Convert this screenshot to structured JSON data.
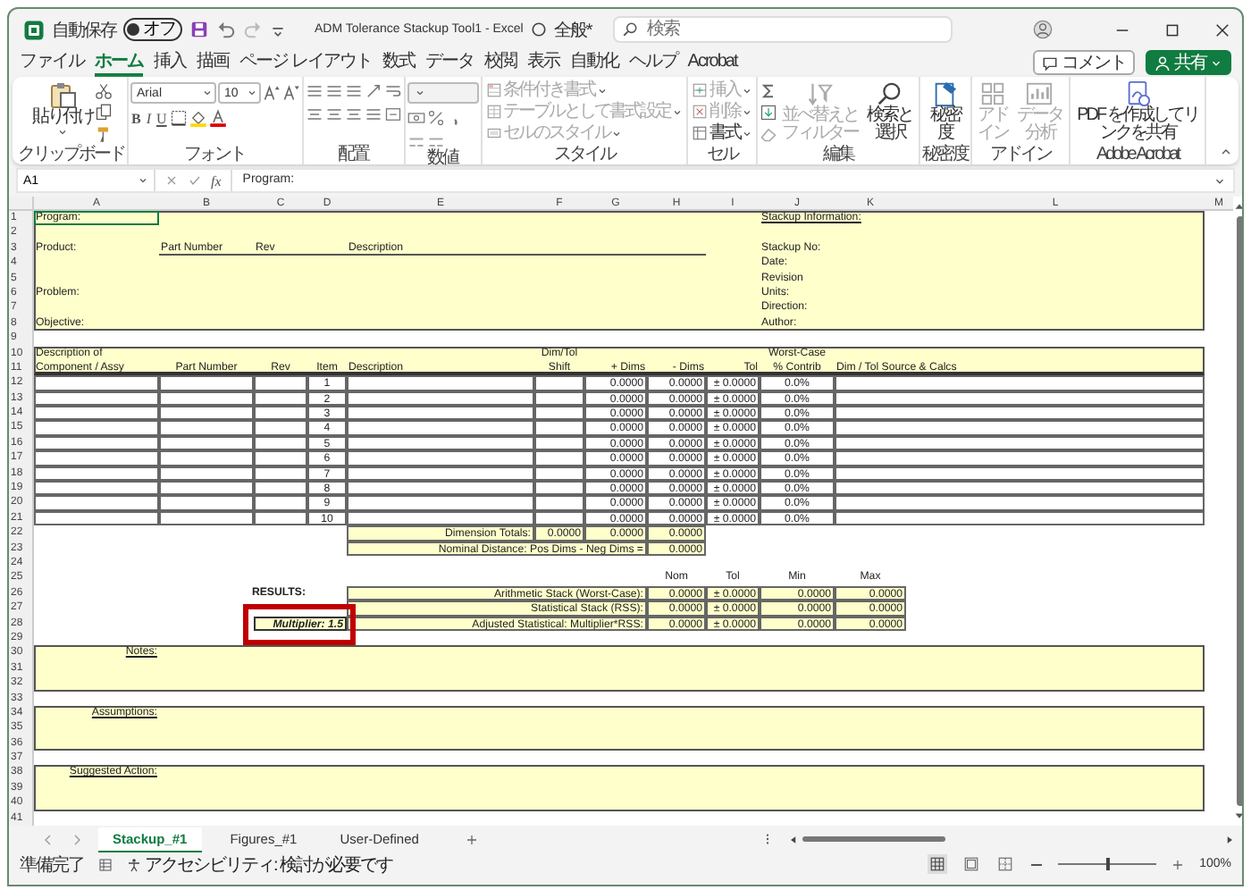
{
  "window": {
    "autosave": "自動保存",
    "autosave_state": "オフ",
    "autosave_on": false,
    "title": "ADM Tolerance Stackup Tool1 - Excel",
    "sensitivity": "全般*",
    "search_placeholder": "検索"
  },
  "menu_tabs": [
    {
      "label": "ファイル",
      "selected": false
    },
    {
      "label": "ホーム",
      "selected": true
    },
    {
      "label": "挿入",
      "selected": false
    },
    {
      "label": "描画",
      "selected": false
    },
    {
      "label": "ページ レイアウト",
      "selected": false
    },
    {
      "label": "数式",
      "selected": false
    },
    {
      "label": "データ",
      "selected": false
    },
    {
      "label": "校閲",
      "selected": false
    },
    {
      "label": "表示",
      "selected": false
    },
    {
      "label": "自動化",
      "selected": false
    },
    {
      "label": "ヘルプ",
      "selected": false
    },
    {
      "label": "Acrobat",
      "selected": false
    }
  ],
  "actions": {
    "comment": "コメント",
    "share": "共有"
  },
  "ribbon": [
    {
      "kind": "clipboard",
      "label": "クリップボード",
      "paste": "貼り付け"
    },
    {
      "kind": "font",
      "label": "フォント",
      "font": "Arial",
      "size": "10",
      "styles": [
        "B",
        "I",
        "U"
      ]
    },
    {
      "kind": "alignment",
      "label": "配置"
    },
    {
      "kind": "number",
      "label": "数値"
    },
    {
      "kind": "list",
      "label": "スタイル",
      "items": [
        {
          "label": "条件付き書式",
          "disabled": true
        },
        {
          "label": "テーブルとして書式設定",
          "disabled": true
        },
        {
          "label": "セルのスタイル",
          "disabled": true
        }
      ]
    },
    {
      "kind": "list",
      "label": "セル",
      "items": [
        {
          "label": "挿入",
          "disabled": true
        },
        {
          "label": "削除",
          "disabled": true
        },
        {
          "label": "書式",
          "disabled": false
        }
      ]
    },
    {
      "kind": "editing",
      "label": "編集",
      "items": [
        {
          "label": "並べ替えとフィルター",
          "disabled": true
        },
        {
          "label": "検索と選択",
          "disabled": false
        }
      ]
    },
    {
      "kind": "big",
      "label": "秘密度",
      "items": [
        {
          "label": "秘密度",
          "disabled": false
        }
      ]
    },
    {
      "kind": "big",
      "label": "アドイン",
      "items": [
        {
          "label": "アドイン",
          "disabled": true
        },
        {
          "label": "データ分析",
          "disabled": true
        }
      ]
    },
    {
      "kind": "big",
      "label": "Adobe Acrobat",
      "items": [
        {
          "label": "PDF を作成してリンクを共有",
          "disabled": false
        }
      ]
    }
  ],
  "formula_bar": {
    "name_box": "A1",
    "fx": "fx",
    "formula": "Program:"
  },
  "sheet": {
    "columns": [
      "A",
      "B",
      "C",
      "D",
      "E",
      "F",
      "G",
      "H",
      "I",
      "J",
      "K",
      "L",
      "M"
    ],
    "rows": [
      "1",
      "2",
      "3",
      "4",
      "5",
      "6",
      "7",
      "8",
      "9",
      "10",
      "11",
      "12",
      "13",
      "14",
      "15",
      "16",
      "17",
      "18",
      "19",
      "20",
      "21",
      "22",
      "23",
      "24",
      "25",
      "26",
      "27",
      "28",
      "29",
      "30",
      "31",
      "32",
      "33",
      "34",
      "35",
      "36",
      "37",
      "38",
      "39",
      "40",
      "41"
    ],
    "header_block": {
      "program": {
        "text": "Program:",
        "selected": true
      },
      "product": "Product:",
      "part_number": "Part Number",
      "rev": "Rev",
      "description": "Description",
      "problem": "Problem:",
      "objective": "Objective:",
      "stackup_title": "Stackup Information:",
      "stackup_fields": [
        "Stackup No:",
        "Date:",
        "Revision",
        "Units:",
        "Direction:",
        "Author:"
      ]
    },
    "stack_table": {
      "description_top": "Description of",
      "dim_tol_top": "Dim/Tol",
      "worst_case_top": "Worst-Case",
      "columns": [
        "Component / Assy",
        "Part Number",
        "Rev",
        "Item",
        "Description",
        "Shift",
        "+ Dims",
        "- Dims",
        "Tol",
        "% Contrib",
        "Dim / Tol Source & Calcs"
      ],
      "rows": [
        {
          "item": "1",
          "plus": "0.0000",
          "minus": "0.0000",
          "tol": "± 0.0000",
          "contrib": "0.0%"
        },
        {
          "item": "2",
          "plus": "0.0000",
          "minus": "0.0000",
          "tol": "± 0.0000",
          "contrib": "0.0%"
        },
        {
          "item": "3",
          "plus": "0.0000",
          "minus": "0.0000",
          "tol": "± 0.0000",
          "contrib": "0.0%"
        },
        {
          "item": "4",
          "plus": "0.0000",
          "minus": "0.0000",
          "tol": "± 0.0000",
          "contrib": "0.0%"
        },
        {
          "item": "5",
          "plus": "0.0000",
          "minus": "0.0000",
          "tol": "± 0.0000",
          "contrib": "0.0%"
        },
        {
          "item": "6",
          "plus": "0.0000",
          "minus": "0.0000",
          "tol": "± 0.0000",
          "contrib": "0.0%"
        },
        {
          "item": "7",
          "plus": "0.0000",
          "minus": "0.0000",
          "tol": "± 0.0000",
          "contrib": "0.0%"
        },
        {
          "item": "8",
          "plus": "0.0000",
          "minus": "0.0000",
          "tol": "± 0.0000",
          "contrib": "0.0%"
        },
        {
          "item": "9",
          "plus": "0.0000",
          "minus": "0.0000",
          "tol": "± 0.0000",
          "contrib": "0.0%"
        },
        {
          "item": "10",
          "plus": "0.0000",
          "minus": "0.0000",
          "tol": "± 0.0000",
          "contrib": "0.0%"
        }
      ]
    },
    "totals": {
      "label": "Dimension Totals:",
      "values": [
        "0.0000",
        "0.0000",
        "0.0000"
      ]
    },
    "nominal": {
      "label": "Nominal Distance: Pos Dims - Neg Dims =",
      "value": "0.0000"
    },
    "results": {
      "title": "RESULTS:",
      "columns": [
        "Nom",
        "Tol",
        "Min",
        "Max"
      ],
      "rows": [
        {
          "label": "Arithmetic Stack (Worst-Case):",
          "values": [
            "0.0000",
            "± 0.0000",
            "0.0000",
            "0.0000"
          ]
        },
        {
          "label": "Statistical Stack (RSS):",
          "values": [
            "0.0000",
            "± 0.0000",
            "0.0000",
            "0.0000"
          ]
        },
        {
          "label": "Adjusted Statistical: Multiplier*RSS:",
          "values": [
            "0.0000",
            "± 0.0000",
            "0.0000",
            "0.0000"
          ]
        }
      ],
      "multiplier": {
        "text": "Multiplier: 1.5",
        "highlighted": true
      }
    },
    "sections": [
      "Notes:",
      "Assumptions:",
      "Suggested Action:"
    ]
  },
  "sheet_tabs": [
    {
      "label": "Stackup_#1",
      "selected": true
    },
    {
      "label": "Figures_#1",
      "selected": false
    },
    {
      "label": "User-Defined",
      "selected": false
    }
  ],
  "status_bar": {
    "ready": "準備完了",
    "accessibility": "アクセシビリティ: 検討が必要です",
    "views": [
      {
        "kind": "normal",
        "selected": true
      },
      {
        "kind": "page-layout",
        "selected": false
      },
      {
        "kind": "page-break",
        "selected": false
      }
    ],
    "zoom": {
      "level": 0.5,
      "label": "100%"
    }
  }
}
